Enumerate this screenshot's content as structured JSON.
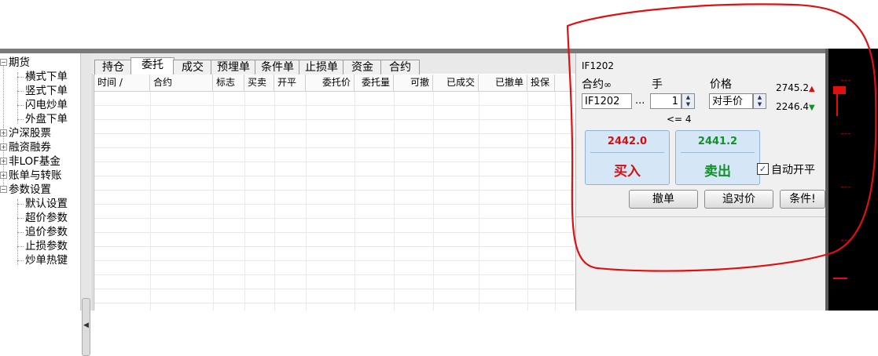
{
  "tree": {
    "items": [
      {
        "label": "期货",
        "expander": "-"
      },
      {
        "label": "横式下单"
      },
      {
        "label": "竖式下单"
      },
      {
        "label": "闪电炒单"
      },
      {
        "label": "外盘下单"
      },
      {
        "label": "沪深股票",
        "expander": "+"
      },
      {
        "label": "融资融券",
        "expander": "+"
      },
      {
        "label": "非LOF基金",
        "expander": "+"
      },
      {
        "label": "账单与转账",
        "expander": "+"
      },
      {
        "label": "参数设置",
        "expander": "-"
      },
      {
        "label": "默认设置"
      },
      {
        "label": "超价参数"
      },
      {
        "label": "追价参数"
      },
      {
        "label": "止损参数"
      },
      {
        "label": "炒单热键"
      }
    ]
  },
  "tabs": [
    "持仓",
    "委托",
    "成交",
    "预埋单",
    "条件单",
    "止损单",
    "资金",
    "合约"
  ],
  "active_tab": "委托",
  "table": {
    "columns": [
      "时间 /",
      "合约",
      "标志",
      "买卖",
      "开平",
      "委托价",
      "委托量",
      "可撤",
      "已成交",
      "已撤单",
      "投保"
    ]
  },
  "order_panel": {
    "symbol_title": "IF1202",
    "contract_label": "合约",
    "link_icon": "∞",
    "lots_label": "手",
    "price_label": "价格",
    "contract_value": "IF1202",
    "browse_label": "...",
    "lots_value": "1",
    "price_value": "对手价",
    "upper_limit": "2745.2",
    "lower_limit": "2246.4",
    "max_hint": "<= 4",
    "buy_price": "2442.0",
    "buy_label": "买入",
    "sell_price": "2441.2",
    "sell_label": "卖出",
    "auto_open_close_label": "自动开平",
    "auto_open_close_checked": "✓",
    "cancel_label": "撤单",
    "chase_label": "追对价",
    "condition_label": "条件!"
  },
  "colors": {
    "buy": "#d11010",
    "sell": "#12902a",
    "annotation": "#e01010"
  }
}
